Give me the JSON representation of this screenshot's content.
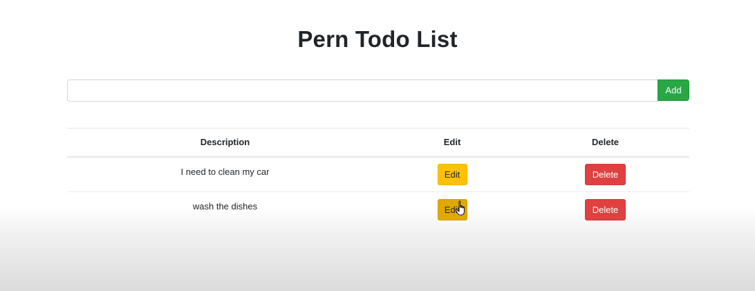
{
  "page": {
    "title": "Pern Todo List"
  },
  "form": {
    "input_value": "",
    "input_placeholder": "",
    "add_label": "Add"
  },
  "table": {
    "headers": [
      "Description",
      "Edit",
      "Delete"
    ],
    "rows": [
      {
        "description": "I need to clean my car",
        "edit_label": "Edit",
        "delete_label": "Delete"
      },
      {
        "description": "wash the dishes",
        "edit_label": "Edit",
        "delete_label": "Delete"
      }
    ]
  },
  "colors": {
    "add": "#28a745",
    "edit": "#ffc107",
    "edit_hover": "#e0a800",
    "delete": "#e04040"
  },
  "cursor": {
    "icon": "hand-pointer-icon"
  }
}
